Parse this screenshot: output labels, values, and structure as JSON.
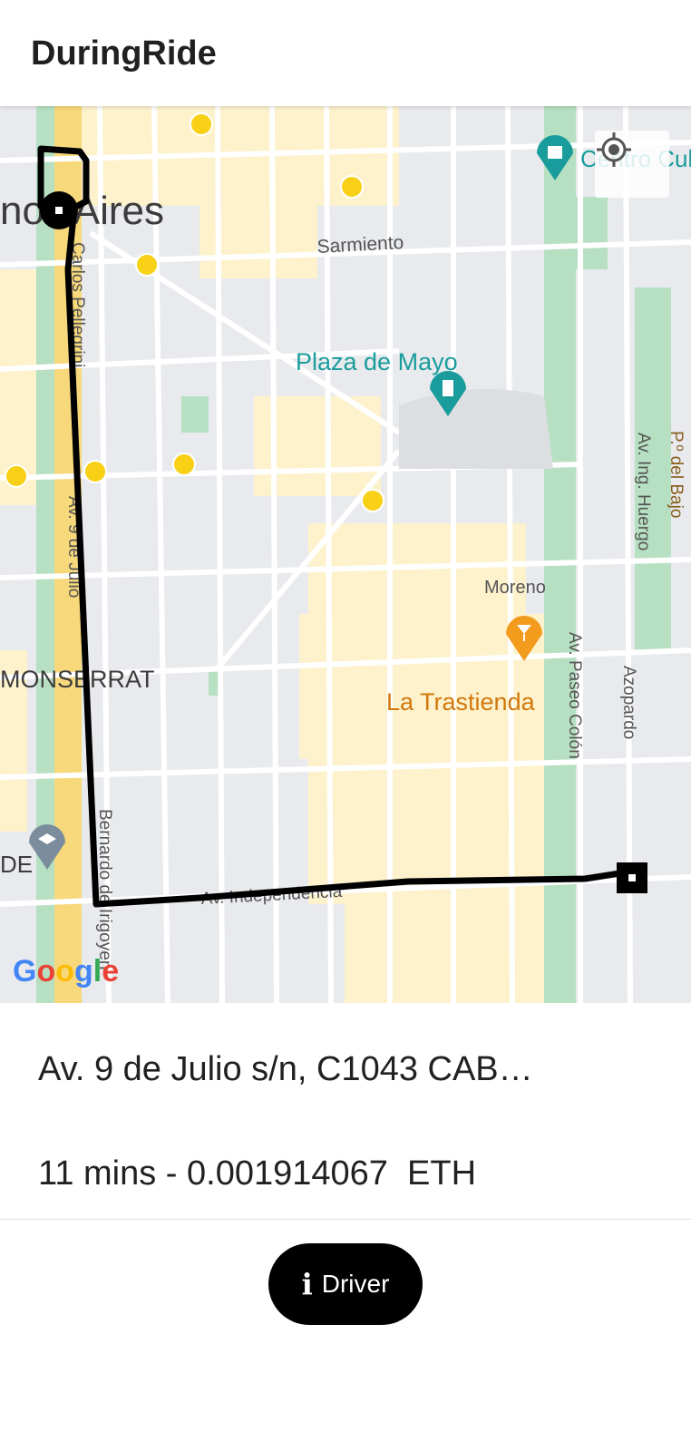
{
  "app": {
    "title": "DuringRide"
  },
  "map": {
    "labels": {
      "city": "nos Aires",
      "sarmiento": "Sarmiento",
      "plaza_de_mayo": "Plaza de Mayo",
      "carlos_pellegrini": "Carlos Pellegrini",
      "av_9_de_julio": "Av. 9 de Julio",
      "moreno": "Moreno",
      "monserrat": "MONSERRAT",
      "la_trastienda": "La Trastienda",
      "av_paseo_colon": "Av. Paseo Colón",
      "azopardo": "Azopardo",
      "av_ing_huergo": "Av. Ing. Huergo",
      "paseo_del_bajo": "P.º del Bajo",
      "av_independencia": "Av. Independencia",
      "bernardo_de_irigoyen": "Bernardo de Irigoyen",
      "centro_cultural": "Centro Cultural Kirchner",
      "de": "DE",
      "subte": "Subte"
    },
    "google_logo": "Google",
    "icons": {
      "locate": "my-location-icon",
      "museum": "museum-pin-icon",
      "monument": "monument-pin-icon",
      "bar": "cocktail-pin-icon",
      "school": "school-pin-icon",
      "subte": "subte-station-icon",
      "origin": "origin-marker-icon",
      "destination": "destination-marker-icon"
    },
    "colors": {
      "route": "#000000",
      "park": "#b7e0c3",
      "block": "#fdf2cc",
      "road": "#ffffff",
      "highway": "#f7d87a",
      "teal_label": "#1a9c9c",
      "orange_label": "#d2780c",
      "subte": "#f8d016"
    }
  },
  "trip": {
    "address": "Av. 9 de Julio s/n, C1043 CAB…",
    "eta_cost": "11 mins - 0.001914067  ETH"
  },
  "actions": {
    "driver_label": "Driver",
    "driver_icon": "info-icon"
  }
}
